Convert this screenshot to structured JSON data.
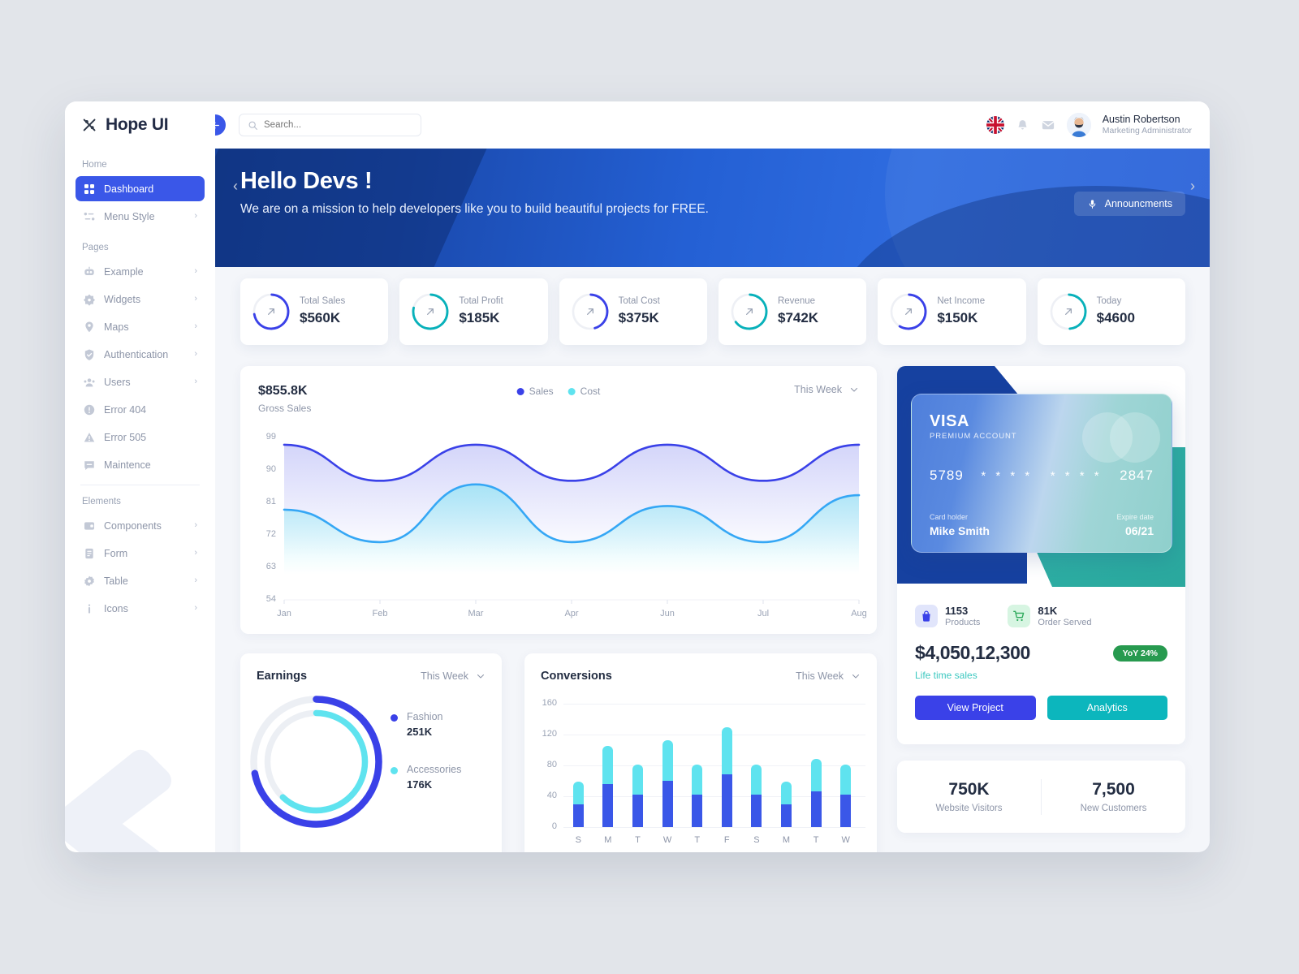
{
  "brand": {
    "name": "Hope UI",
    "logo_icon": "hope-logo-icon"
  },
  "topbar": {
    "back_icon": "arrow-left-icon",
    "search": {
      "placeholder": "Search...",
      "value": "",
      "icon": "search-icon"
    },
    "flag_icon": "uk-flag-icon",
    "bell_icon": "bell-icon",
    "mail_icon": "mail-icon",
    "user": {
      "name": "Austin Robertson",
      "role": "Marketing Administrator",
      "avatar_icon": "avatar"
    }
  },
  "sidebar": {
    "sections": [
      {
        "label": "Home",
        "items": [
          {
            "label": "Dashboard",
            "icon": "grid-icon",
            "active": true,
            "chevron": ""
          },
          {
            "label": "Menu Style",
            "icon": "list-icon",
            "active": false,
            "chevron": "›"
          }
        ]
      },
      {
        "label": "Pages",
        "items": [
          {
            "label": "Example",
            "icon": "robot-icon",
            "active": false,
            "chevron": "›"
          },
          {
            "label": "Widgets",
            "icon": "widget-icon",
            "active": false,
            "chevron": "›"
          },
          {
            "label": "Maps",
            "icon": "map-pin-icon",
            "active": false,
            "chevron": "›"
          },
          {
            "label": "Authentication",
            "icon": "shield-check-icon",
            "active": false,
            "chevron": "›"
          },
          {
            "label": "Users",
            "icon": "users-icon",
            "active": false,
            "chevron": "›"
          },
          {
            "label": "Error 404",
            "icon": "alert-circle-icon",
            "active": false,
            "chevron": ""
          },
          {
            "label": "Error 505",
            "icon": "alert-triangle-icon",
            "active": false,
            "chevron": ""
          },
          {
            "label": "Maintence",
            "icon": "message-icon",
            "active": false,
            "chevron": ""
          }
        ]
      },
      {
        "label": "Elements",
        "items": [
          {
            "label": "Components",
            "icon": "components-icon",
            "active": false,
            "chevron": "›"
          },
          {
            "label": "Form",
            "icon": "form-icon",
            "active": false,
            "chevron": "›"
          },
          {
            "label": "Table",
            "icon": "table-icon",
            "active": false,
            "chevron": "›"
          },
          {
            "label": "Icons",
            "icon": "info-icon",
            "active": false,
            "chevron": "›"
          }
        ]
      }
    ]
  },
  "hero": {
    "title": "Hello Devs !",
    "subtitle": "We are on a mission to help developers like you to build beautiful projects for FREE.",
    "announce_label": "Announcments",
    "announce_icon": "mic-icon"
  },
  "stats": {
    "next_icon": "›",
    "prev_icon": "‹",
    "cards": [
      {
        "label": "Total Sales",
        "value": "$560K",
        "color": "#3a41e8",
        "pct": 72,
        "icon": "trend-up-icon"
      },
      {
        "label": "Total Profit",
        "value": "$185K",
        "color": "#08b1ba",
        "pct": 78,
        "icon": "trend-up-icon"
      },
      {
        "label": "Total Cost",
        "value": "$375K",
        "color": "#3a41e8",
        "pct": 45,
        "icon": "trend-up-icon"
      },
      {
        "label": "Revenue",
        "value": "$742K",
        "color": "#08b1ba",
        "pct": 64,
        "icon": "trend-up-icon"
      },
      {
        "label": "Net Income",
        "value": "$150K",
        "color": "#3a41e8",
        "pct": 58,
        "icon": "trend-up-icon"
      },
      {
        "label": "Today",
        "value": "$4600",
        "color": "#08b1ba",
        "pct": 48,
        "icon": "trend-up-icon"
      }
    ]
  },
  "gross_sales": {
    "amount": "$855.8K",
    "label": "Gross Sales",
    "period": "This Week",
    "chevron_icon": "chevron-down-icon",
    "legend": [
      {
        "name": "Sales",
        "color": "#3a41e8"
      },
      {
        "name": "Cost",
        "color": "#5fe3ef"
      }
    ]
  },
  "chart_data": [
    {
      "type": "area",
      "title": "Gross Sales",
      "xlabel": "",
      "ylabel": "",
      "x": [
        "Jan",
        "Feb",
        "Mar",
        "Apr",
        "Jun",
        "Jul",
        "Aug"
      ],
      "ylim": [
        54,
        99
      ],
      "yticks": [
        54,
        63,
        72,
        81,
        90,
        99
      ],
      "grid": false,
      "legend_position": "top-center",
      "series": [
        {
          "name": "Sales",
          "color": "#3a41e8",
          "values": [
            97,
            87,
            97,
            87,
            97,
            87,
            97
          ]
        },
        {
          "name": "Cost",
          "color": "#35a7f5",
          "values": [
            79,
            70,
            86,
            70,
            80,
            70,
            83
          ]
        }
      ]
    },
    {
      "type": "pie",
      "title": "Earnings",
      "period": "This Week",
      "legend_position": "right",
      "rings": [
        {
          "name": "Fashion",
          "value": "251K",
          "numeric": 251,
          "color": "#3a41e8",
          "pct": 72
        },
        {
          "name": "Accessories",
          "value": "176K",
          "numeric": 176,
          "color": "#5fe3ef",
          "pct": 62
        }
      ]
    },
    {
      "type": "bar",
      "title": "Conversions",
      "period": "This Week",
      "stacked": true,
      "categories": [
        "S",
        "M",
        "T",
        "W",
        "T",
        "F",
        "S",
        "M",
        "T",
        "W"
      ],
      "ylim": [
        0,
        160
      ],
      "yticks": [
        0,
        40,
        80,
        120,
        160
      ],
      "grid": true,
      "series": [
        {
          "name": "base",
          "color": "#3a57e8",
          "values": [
            30,
            56,
            42,
            60,
            42,
            68,
            42,
            30,
            46,
            42
          ]
        },
        {
          "name": "top",
          "color": "#5fe3ef",
          "values": [
            29,
            49,
            39,
            53,
            39,
            62,
            39,
            29,
            42,
            39
          ]
        }
      ],
      "totals": [
        59,
        105,
        81,
        113,
        81,
        130,
        81,
        59,
        88,
        81
      ]
    }
  ],
  "visa": {
    "brand": "VISA",
    "account_type": "PREMIUM ACCOUNT",
    "number_first": "5789",
    "number_mask_1": "* * * *",
    "number_mask_2": "* * * *",
    "number_last": "2847",
    "holder_label": "Card holder",
    "holder_name": "Mike Smith",
    "expiry_label": "Expire date",
    "expiry_value": "06/21"
  },
  "account_summary": {
    "mini_stats": [
      {
        "value": "1153",
        "label": "Products",
        "icon": "bag-icon",
        "bg": "#e1e5fb",
        "fg": "#3a41e8"
      },
      {
        "value": "81K",
        "label": "Order Served",
        "icon": "cart-icon",
        "bg": "#d7f5e2",
        "fg": "#2eaa5c"
      }
    ],
    "lifetime_amount": "$4,050,12,300",
    "lifetime_label": "Life time sales",
    "yoy_badge": "YoY 24%",
    "buttons": [
      {
        "label": "View Project",
        "color": "#3a41e8"
      },
      {
        "label": "Analytics",
        "color": "#0cb6bd"
      }
    ]
  },
  "visitors": {
    "items": [
      {
        "value": "750K",
        "label": "Website Visitors"
      },
      {
        "value": "7,500",
        "label": "New Customers"
      }
    ]
  }
}
